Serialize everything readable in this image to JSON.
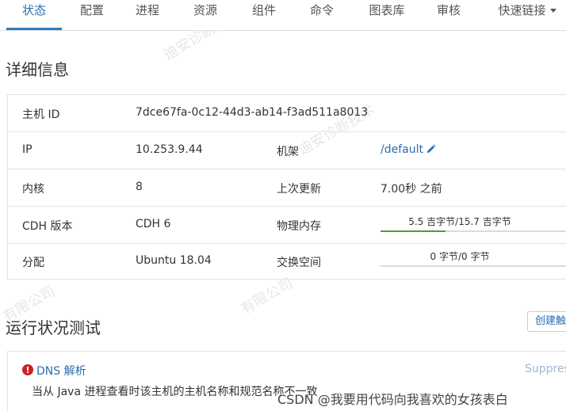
{
  "tabs": [
    {
      "label": "状态",
      "active": true
    },
    {
      "label": "配置",
      "active": false
    },
    {
      "label": "进程",
      "active": false
    },
    {
      "label": "资源",
      "active": false
    },
    {
      "label": "组件",
      "active": false
    },
    {
      "label": "命令",
      "active": false
    },
    {
      "label": "图表库",
      "active": false
    },
    {
      "label": "审核",
      "active": false
    },
    {
      "label": "快速链接",
      "active": false
    }
  ],
  "details": {
    "title": "详细信息",
    "host_id_label": "主机 ID",
    "host_id_value": "7dce67fa-0c12-44d3-ab14-f3ad511a8013",
    "ip_label": "IP",
    "ip_value": "10.253.9.44",
    "rack_label": "机架",
    "rack_value": "/default",
    "cores_label": "内核",
    "cores_value": "8",
    "last_update_label": "上次更新",
    "last_update_value": "7.00秒 之前",
    "cdh_label": "CDH 版本",
    "cdh_value": "CDH 6",
    "memory_label": "物理内存",
    "memory_value": "5.5 吉字节/15.7 吉字节",
    "memory_used_fraction": 0.35,
    "distro_label": "分配",
    "distro_value": "Ubuntu 18.04",
    "swap_label": "交换空间",
    "swap_value": "0 字节/0 字节",
    "swap_used_fraction": 0
  },
  "health": {
    "title": "运行状况测试",
    "create_button": "创建触",
    "test_name": "DNS 解析",
    "suppress_label": "Suppres",
    "description": "当从 Java 进程查看时该主机的主机名称和规范名称不一致"
  },
  "credit": "CSDN @我要用代码向我喜欢的女孩表白",
  "colors": {
    "accent": "#2b7bc4",
    "link": "#2b6cb0",
    "memory_bar": "#5a9a2b",
    "error": "#cc2222"
  }
}
